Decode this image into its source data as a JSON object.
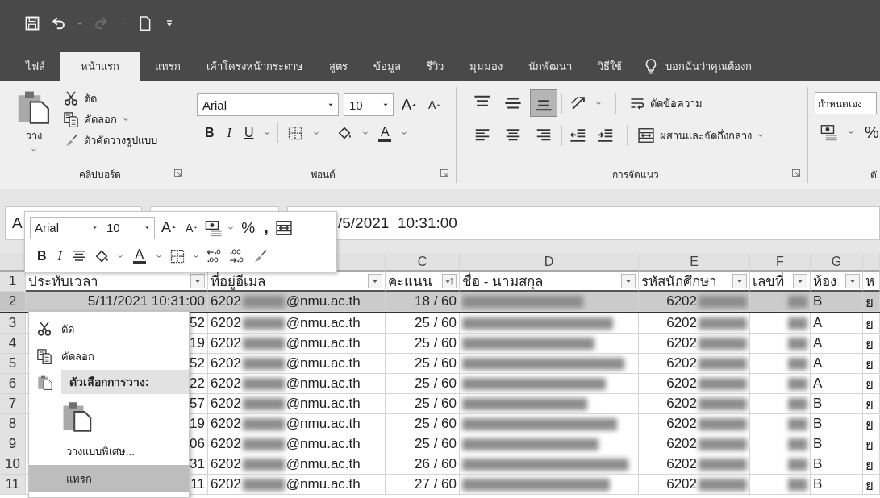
{
  "quick_access": {
    "redo": {
      "disabled": true
    }
  },
  "tabs": [
    {
      "label": "ไฟล์",
      "selected": false
    },
    {
      "label": "หน้าแรก",
      "selected": true
    },
    {
      "label": "แทรก",
      "selected": false
    },
    {
      "label": "เค้าโครงหน้ากระดาษ",
      "selected": false
    },
    {
      "label": "สูตร",
      "selected": false
    },
    {
      "label": "ข้อมูล",
      "selected": false
    },
    {
      "label": "รีวิว",
      "selected": false
    },
    {
      "label": "มุมมอง",
      "selected": false
    },
    {
      "label": "นักพัฒนา",
      "selected": false
    },
    {
      "label": "วิธีใช้",
      "selected": false
    }
  ],
  "tell_me": "บอกฉันว่าคุณต้องก",
  "ribbon": {
    "clipboard": {
      "paste": "วาง",
      "items": [
        "ตัด",
        "คัดลอก",
        "ตัวคัดวางรูปแบบ"
      ],
      "label": "คลิปบอร์ด"
    },
    "font": {
      "font": "Arial",
      "size": "10",
      "grow": "A",
      "shrink": "A",
      "bold": "B",
      "italic": "I",
      "underline": "U",
      "font_color_letter": "A",
      "label": "ฟอนต์"
    },
    "alignment": {
      "vertical": [
        {
          "selected": false
        },
        {
          "selected": false
        },
        {
          "selected": true
        }
      ],
      "wrap": "ตัดข้อความ",
      "merge": "ผสานและจัดกึ่งกลาง",
      "label": "การจัดแนว"
    },
    "number": {
      "format": "กำหนดเอง",
      "percent": "%",
      "label": "ตั"
    }
  },
  "formula_bar": {
    "name_box": "A",
    "value": "/5/2021  10:31:00"
  },
  "mini_toolbar": {
    "font": "Arial",
    "size": "10",
    "grow": "A",
    "shrink": "A",
    "percent": "%",
    "comma": ",",
    "bold": "B",
    "italic": "I",
    "font_color_letter": "A"
  },
  "grid": {
    "column_headers": [
      "C",
      "D",
      "E",
      "F",
      "G"
    ],
    "header_row": {
      "number": "1",
      "cells": [
        "ประทับเวลา",
        "ที่อยู่อีเมล",
        "คะแนน",
        "ชื่อ - นามสกุล",
        "รหัสนักศึกษา",
        "เลขที่",
        "ห้อง",
        "ห"
      ]
    },
    "rows": [
      {
        "number": "2",
        "selected": true,
        "time": "5/11/2021 10:31:00",
        "email_prefix": "6202",
        "email_domain": "@nmu.ac.th",
        "score": "18 / 60",
        "id_prefix": "6202",
        "room": "B",
        "column_h": "ย"
      },
      {
        "number": "3",
        "selected": false,
        "time": "52",
        "email_prefix": "6202",
        "email_domain": "@nmu.ac.th",
        "score": "25 / 60",
        "id_prefix": "6202",
        "room": "A",
        "column_h": "ย"
      },
      {
        "number": "4",
        "selected": false,
        "time": "19",
        "email_prefix": "6202",
        "email_domain": "@nmu.ac.th",
        "score": "25 / 60",
        "id_prefix": "6202",
        "room": "A",
        "column_h": "ย"
      },
      {
        "number": "5",
        "selected": false,
        "time": "52",
        "email_prefix": "6202",
        "email_domain": "@nmu.ac.th",
        "score": "25 / 60",
        "id_prefix": "6202",
        "room": "A",
        "column_h": "ย"
      },
      {
        "number": "6",
        "selected": false,
        "time": "22",
        "email_prefix": "6202",
        "email_domain": "@nmu.ac.th",
        "score": "25 / 60",
        "id_prefix": "6202",
        "room": "A",
        "column_h": "ย"
      },
      {
        "number": "7",
        "selected": false,
        "time": "57",
        "email_prefix": "6202",
        "email_domain": "@nmu.ac.th",
        "score": "25 / 60",
        "id_prefix": "6202",
        "room": "B",
        "column_h": "ย"
      },
      {
        "number": "8",
        "selected": false,
        "time": "19",
        "email_prefix": "6202",
        "email_domain": "@nmu.ac.th",
        "score": "25 / 60",
        "id_prefix": "6202",
        "room": "B",
        "column_h": "ย"
      },
      {
        "number": "9",
        "selected": false,
        "time": "06",
        "email_prefix": "6202",
        "email_domain": "@nmu.ac.th",
        "score": "25 / 60",
        "id_prefix": "6202",
        "room": "B",
        "column_h": "ย"
      },
      {
        "number": "10",
        "selected": false,
        "time": "31",
        "email_prefix": "6202",
        "email_domain": "@nmu.ac.th",
        "score": "26 / 60",
        "id_prefix": "6202",
        "room": "B",
        "column_h": "ย"
      },
      {
        "number": "11",
        "selected": false,
        "time": "11",
        "email_prefix": "6202",
        "email_domain": "@nmu.ac.th",
        "score": "27 / 60",
        "id_prefix": "6202",
        "room": "B",
        "column_h": "ย"
      }
    ]
  },
  "context_menu": {
    "items": [
      {
        "kind": "cut",
        "label": "ตัด",
        "selected": false
      },
      {
        "kind": "copy",
        "label": "คัดลอก",
        "selected": false
      },
      {
        "kind": "heading",
        "label": "ตัวเลือกการวาง:",
        "selected": false
      },
      {
        "kind": "paste",
        "selected": false
      },
      {
        "kind": "plain",
        "label": "วางแบบพิเศษ...",
        "selected": false
      },
      {
        "kind": "plain",
        "label": "แทรก",
        "selected": true
      }
    ]
  }
}
